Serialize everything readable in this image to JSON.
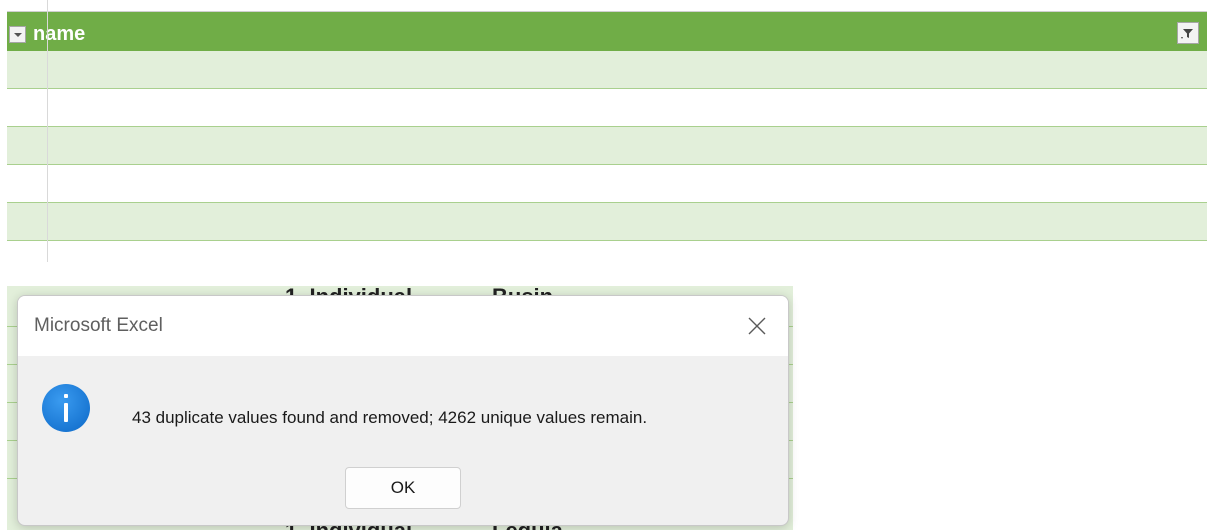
{
  "table": {
    "header_label": "name",
    "header_color": "#70ad47",
    "band_color": "#e2efda",
    "rows": [
      "",
      "",
      "",
      "",
      ""
    ]
  },
  "background_sheet": {
    "visible_texts": [
      "1. Individual",
      "Busin",
      "1. Individual",
      "Legula"
    ]
  },
  "dialog": {
    "title": "Microsoft Excel",
    "message": "43 duplicate values found and removed; 4262 unique values remain.",
    "ok_label": "OK",
    "icon": "info-icon",
    "icon_color": "#0c68c7"
  }
}
